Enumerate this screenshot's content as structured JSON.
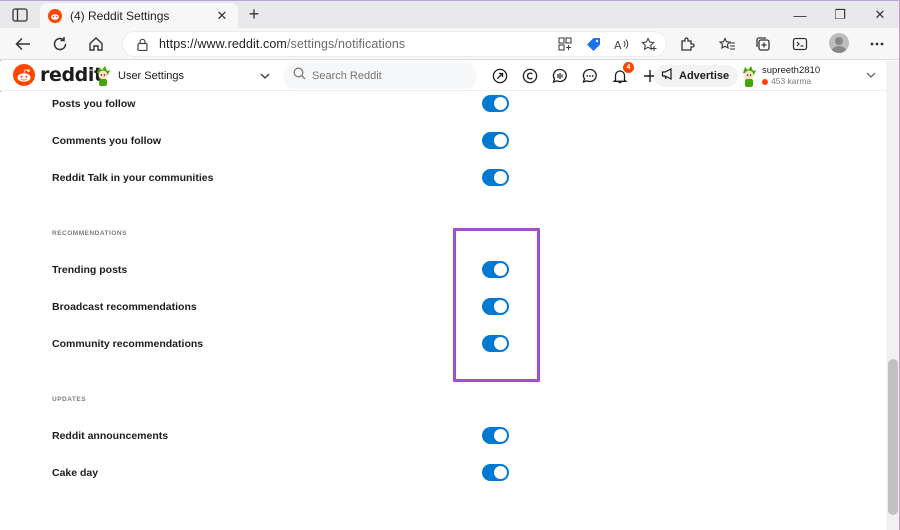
{
  "browser": {
    "tab_title": "(4) Reddit Settings",
    "tab_close": "✕",
    "new_tab": "+",
    "url_host": "https://www.reddit.com",
    "url_path": "/settings/notifications",
    "window_buttons": [
      "—",
      "❐",
      "✕"
    ]
  },
  "header": {
    "logo_text": "reddit",
    "community_label": "User Settings",
    "search_placeholder": "Search Reddit",
    "notification_count": "4",
    "advertise_label": "Advertise",
    "username": "supreeth2810",
    "karma": "453 karma"
  },
  "sections": {
    "top_rows": [
      {
        "label": "Posts you follow",
        "on": true
      },
      {
        "label": "Comments you follow",
        "on": true
      },
      {
        "label": "Reddit Talk in your communities",
        "on": true
      }
    ],
    "recommendations": {
      "title": "RECOMMENDATIONS",
      "rows": [
        {
          "label": "Trending posts",
          "on": true
        },
        {
          "label": "Broadcast recommendations",
          "on": true
        },
        {
          "label": "Community recommendations",
          "on": true
        }
      ]
    },
    "updates": {
      "title": "UPDATES",
      "rows": [
        {
          "label": "Reddit announcements",
          "on": true
        },
        {
          "label": "Cake day",
          "on": true
        }
      ]
    }
  },
  "colors": {
    "toggle_on": "#0079d3",
    "reddit_orange": "#ff4500",
    "highlight": "#a24fd0"
  }
}
